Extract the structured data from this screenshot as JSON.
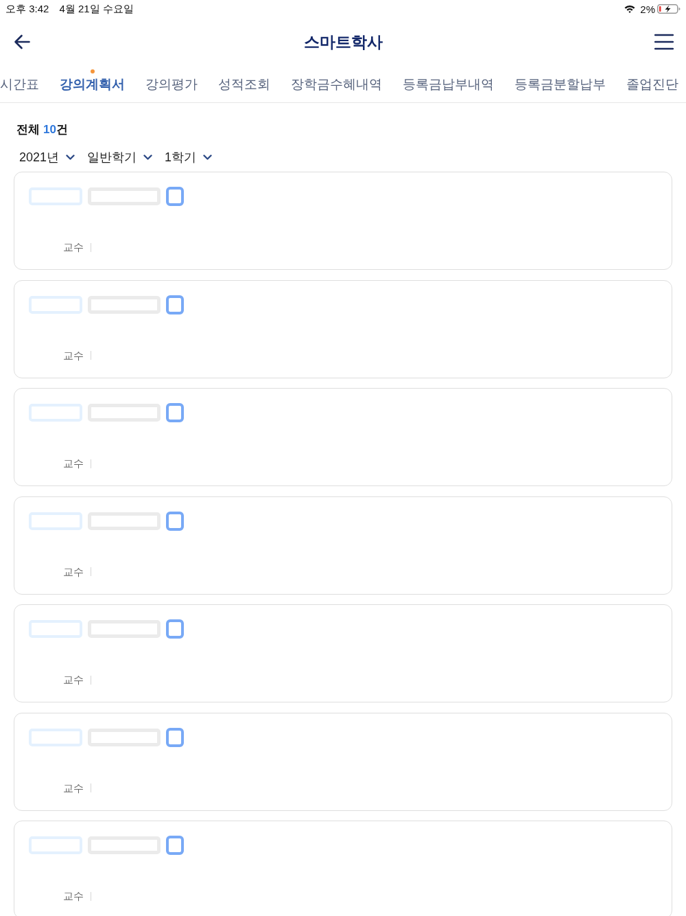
{
  "status_bar": {
    "time": "오후 3:42",
    "date": "4월 21일 수요일",
    "battery_percent": "2%"
  },
  "header": {
    "title": "스마트학사"
  },
  "tabs": [
    {
      "label": "시간표",
      "selected": false,
      "new": false
    },
    {
      "label": "강의계획서",
      "selected": true,
      "new": true
    },
    {
      "label": "강의평가",
      "selected": false,
      "new": false
    },
    {
      "label": "성적조회",
      "selected": false,
      "new": false
    },
    {
      "label": "장학금수혜내역",
      "selected": false,
      "new": false
    },
    {
      "label": "등록금납부내역",
      "selected": false,
      "new": false
    },
    {
      "label": "등록금분할납부",
      "selected": false,
      "new": false
    },
    {
      "label": "졸업진단",
      "selected": false,
      "new": false
    }
  ],
  "summary": {
    "label": "전체",
    "count": "10",
    "unit": "건"
  },
  "filters": [
    {
      "label": "2021년"
    },
    {
      "label": "일반학기"
    },
    {
      "label": "1학기"
    }
  ],
  "courses": [
    {
      "professor_label": "교수"
    },
    {
      "professor_label": "교수"
    },
    {
      "professor_label": "교수"
    },
    {
      "professor_label": "교수"
    },
    {
      "professor_label": "교수"
    },
    {
      "professor_label": "교수"
    },
    {
      "professor_label": "교수"
    }
  ]
}
